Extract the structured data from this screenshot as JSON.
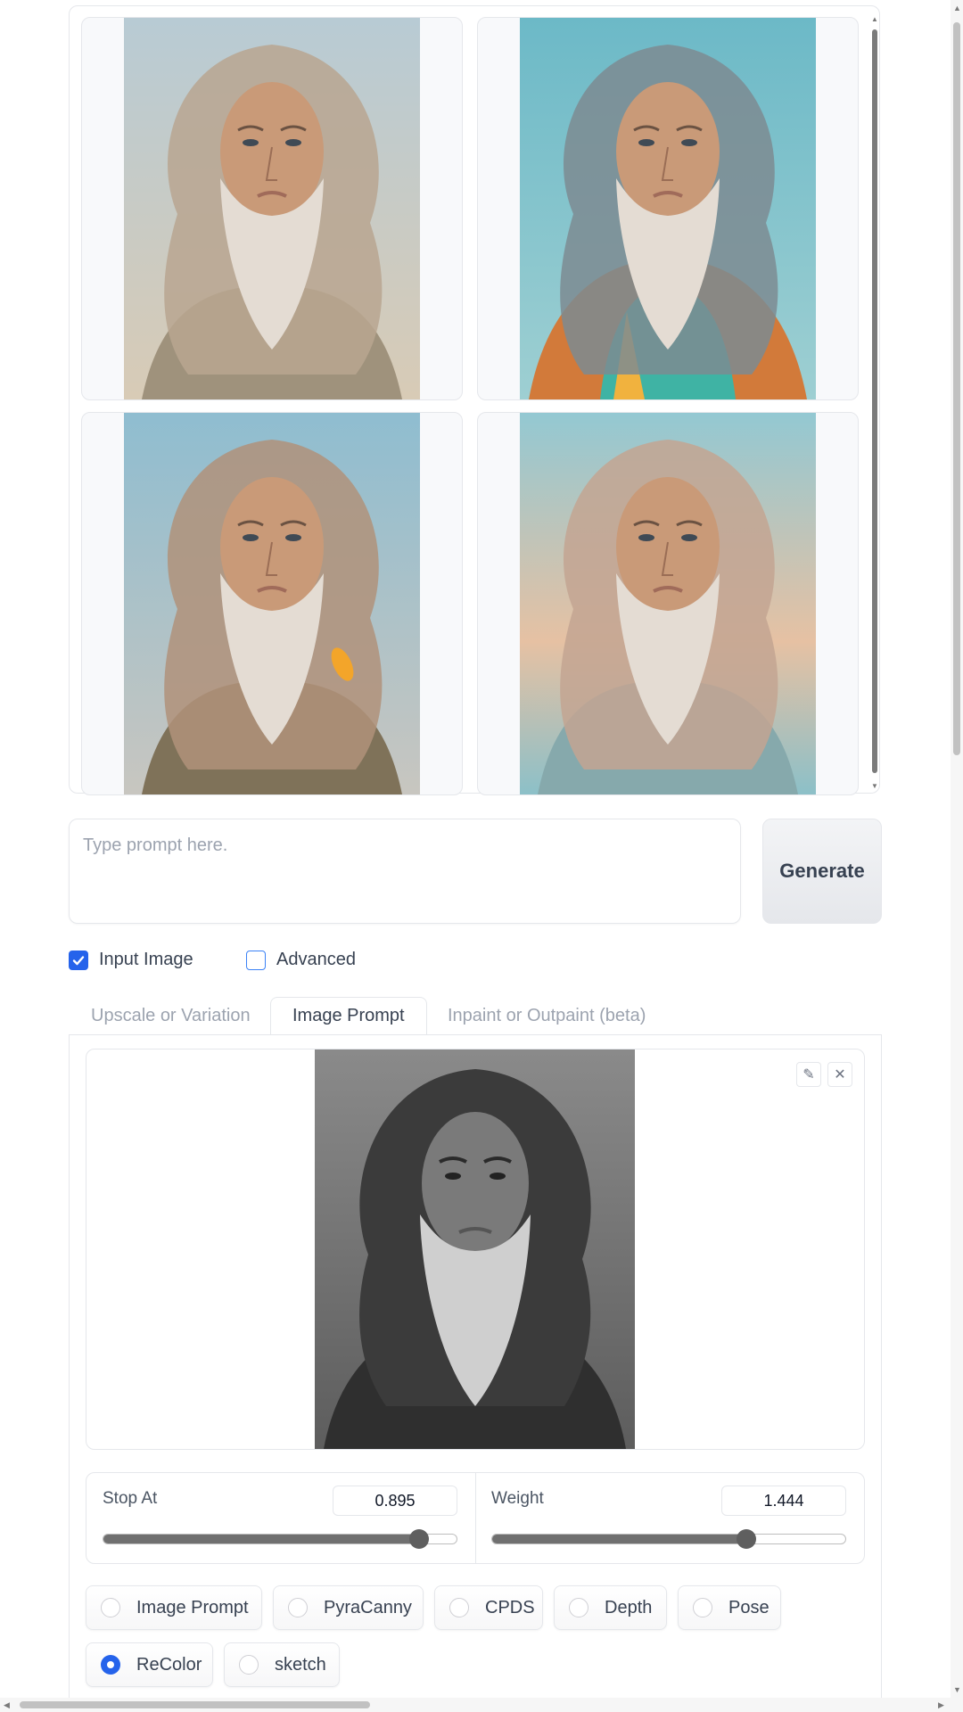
{
  "gallery": {
    "images": [
      {
        "alt": "old man with long gray hair and beard, muted beige tones"
      },
      {
        "alt": "old man with long gray hair and beard, colorful teal and orange robe"
      },
      {
        "alt": "old man with long gray hair and beard, blue sky and brown robe"
      },
      {
        "alt": "old man with long gray hair and beard, soft teal and peach tones"
      }
    ]
  },
  "prompt": {
    "placeholder": "Type prompt here.",
    "value": ""
  },
  "generate_label": "Generate",
  "options": {
    "input_image_label": "Input Image",
    "input_image_checked": true,
    "advanced_label": "Advanced",
    "advanced_checked": false
  },
  "tabs": [
    {
      "label": "Upscale or Variation",
      "active": false
    },
    {
      "label": "Image Prompt",
      "active": true
    },
    {
      "label": "Inpaint or Outpaint (beta)",
      "active": false
    }
  ],
  "input_image": {
    "alt": "black and white portrait of old man with long curly hair and beard"
  },
  "sliders": {
    "stop_at": {
      "label": "Stop At",
      "value": "0.895",
      "fraction": 0.895
    },
    "weight": {
      "label": "Weight",
      "value": "1.444",
      "fraction": 0.72
    }
  },
  "radio_options": [
    {
      "label": "Image Prompt",
      "selected": false
    },
    {
      "label": "PyraCanny",
      "selected": false
    },
    {
      "label": "CPDS",
      "selected": false
    },
    {
      "label": "Depth",
      "selected": false
    },
    {
      "label": "Pose",
      "selected": false
    },
    {
      "label": "ReColor",
      "selected": true
    },
    {
      "label": "sketch",
      "selected": false
    }
  ],
  "icons": {
    "edit": "pencil-icon",
    "clear": "close-icon",
    "checkbox_check": "check-icon"
  },
  "colors": {
    "accent": "#2563eb",
    "slider_fill": "#707070"
  }
}
